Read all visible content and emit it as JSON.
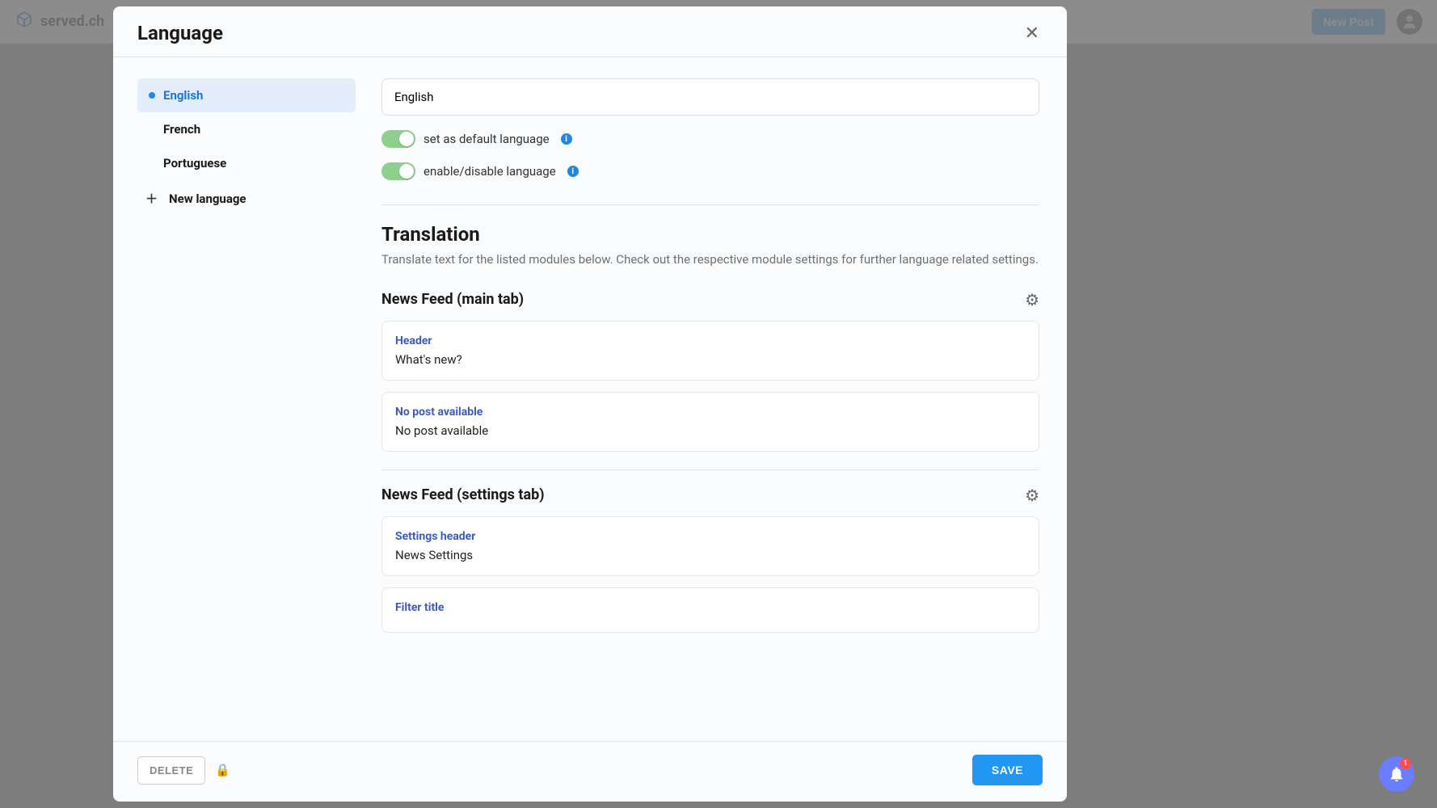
{
  "topbar": {
    "brand": "served.ch",
    "new_post": "New Post"
  },
  "dialog": {
    "title": "Language",
    "sidebar": {
      "languages": [
        {
          "name": "English",
          "active": true
        },
        {
          "name": "French",
          "active": false
        },
        {
          "name": "Portuguese",
          "active": false
        }
      ],
      "new_language": "New language"
    },
    "form": {
      "name_value": "English",
      "toggles": [
        {
          "label": "set as default language",
          "on": true
        },
        {
          "label": "enable/disable language",
          "on": true
        }
      ]
    },
    "translation": {
      "title": "Translation",
      "description": "Translate text for the listed modules below. Check out the respective module settings for further language related settings.",
      "modules": [
        {
          "title": "News Feed (main tab)",
          "fields": [
            {
              "label": "Header",
              "value": "What's new?"
            },
            {
              "label": "No post available",
              "value": "No post available"
            }
          ]
        },
        {
          "title": "News Feed (settings tab)",
          "fields": [
            {
              "label": "Settings header",
              "value": "News Settings"
            },
            {
              "label": "Filter title",
              "value": ""
            }
          ]
        }
      ]
    },
    "footer": {
      "delete": "DELETE",
      "save": "SAVE"
    }
  },
  "notifications": {
    "count": "1"
  }
}
